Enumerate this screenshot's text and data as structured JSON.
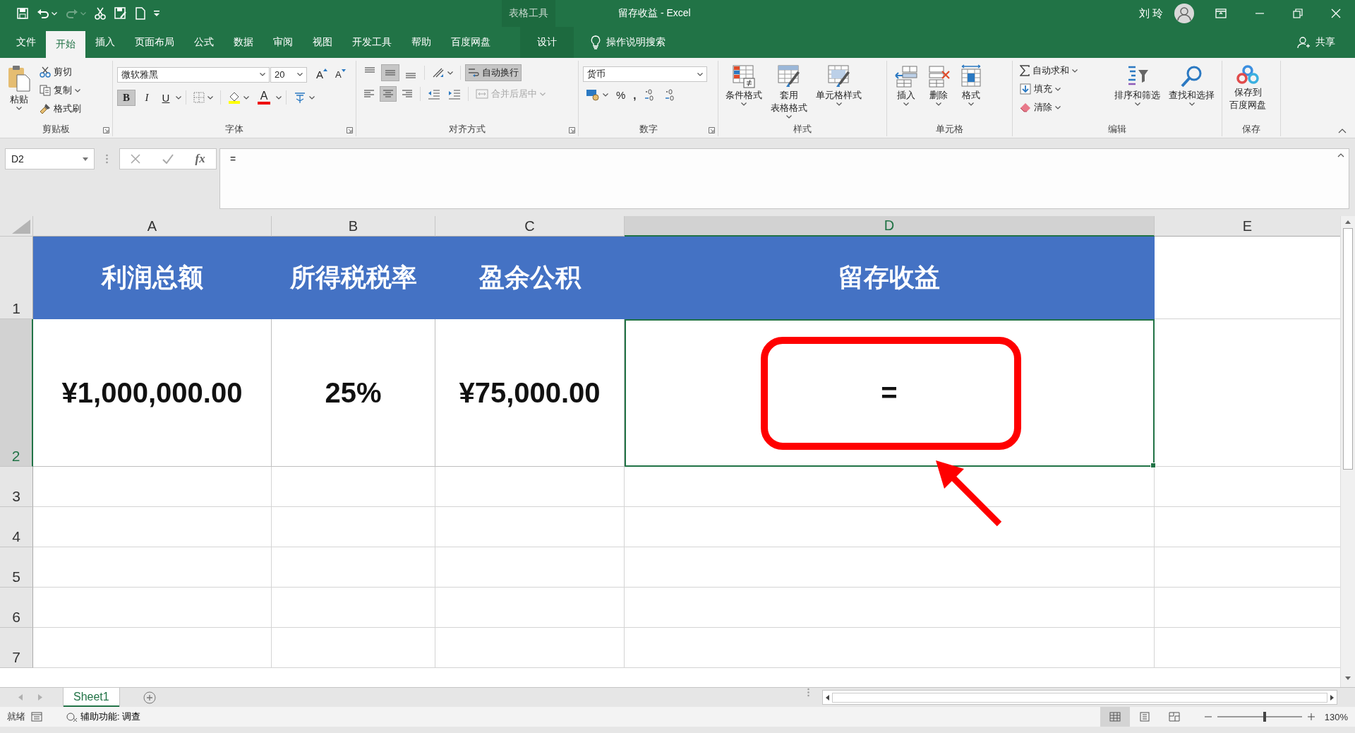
{
  "title_bar": {
    "context_group": "表格工具",
    "title": "留存收益  -  Excel",
    "user": "刘 玲"
  },
  "ribbon_tabs": [
    {
      "label": "文件",
      "selected": false,
      "kind": "normal"
    },
    {
      "label": "开始",
      "selected": true,
      "kind": "normal"
    },
    {
      "label": "插入",
      "selected": false,
      "kind": "normal"
    },
    {
      "label": "页面布局",
      "selected": false,
      "kind": "normal"
    },
    {
      "label": "公式",
      "selected": false,
      "kind": "normal"
    },
    {
      "label": "数据",
      "selected": false,
      "kind": "normal"
    },
    {
      "label": "审阅",
      "selected": false,
      "kind": "normal"
    },
    {
      "label": "视图",
      "selected": false,
      "kind": "normal"
    },
    {
      "label": "开发工具",
      "selected": false,
      "kind": "normal"
    },
    {
      "label": "帮助",
      "selected": false,
      "kind": "normal"
    },
    {
      "label": "百度网盘",
      "selected": false,
      "kind": "normal"
    },
    {
      "label": "设计",
      "selected": false,
      "kind": "context"
    }
  ],
  "tell_me": "操作说明搜索",
  "share": "共享",
  "ribbon": {
    "clipboard": {
      "label": "剪贴板",
      "paste": "粘贴",
      "cut": "剪切",
      "copy": "复制",
      "format_painter": "格式刷"
    },
    "font": {
      "label": "字体",
      "font_name": "微软雅黑",
      "font_size": "20",
      "grow": "A",
      "shrink": "A",
      "styles": [
        {
          "label": "B",
          "selected": true
        },
        {
          "label": "I",
          "selected": false
        },
        {
          "label": "U",
          "selected": false
        }
      ],
      "font_color": "A"
    },
    "alignment": {
      "label": "对齐方式",
      "vertical": [
        {
          "selected": false
        },
        {
          "selected": true
        },
        {
          "selected": false
        }
      ],
      "horizontal": [
        {
          "selected": false
        },
        {
          "selected": true
        },
        {
          "selected": false
        }
      ],
      "wrap_text": {
        "label": "自动换行",
        "selected": true
      },
      "merge": {
        "label": "合并后居中",
        "disabled": true
      }
    },
    "number": {
      "label": "数字",
      "format": "货币",
      "percent": "%",
      "comma": ","
    },
    "styles": {
      "label": "样式",
      "buttons": [
        {
          "lines": [
            "条件格式"
          ]
        },
        {
          "lines": [
            "套用",
            "表格格式"
          ]
        },
        {
          "lines": [
            "单元格样式"
          ]
        }
      ]
    },
    "cells": {
      "label": "单元格",
      "buttons": [
        "插入",
        "删除",
        "格式"
      ]
    },
    "editing": {
      "label": "编辑",
      "small": [
        "自动求和",
        "填充",
        "清除"
      ],
      "large": [
        "排序和筛选",
        "查找和选择"
      ]
    },
    "save": {
      "label": "保存",
      "lines": [
        "保存到",
        "百度网盘"
      ]
    }
  },
  "formula_bar": {
    "name_box": "D2",
    "function_button": "fx",
    "formula": "="
  },
  "sheet": {
    "columns": [
      {
        "label": "A",
        "selected": false
      },
      {
        "label": "B",
        "selected": false
      },
      {
        "label": "C",
        "selected": false
      },
      {
        "label": "D",
        "selected": true
      },
      {
        "label": "E",
        "selected": false
      }
    ],
    "rows": [
      {
        "label": "1",
        "selected": false,
        "kind": "header",
        "cells": [
          "利润总额",
          "所得税税率",
          "盈余公积",
          "留存收益"
        ]
      },
      {
        "label": "2",
        "selected": true,
        "kind": "data",
        "cells": [
          "¥1,000,000.00",
          "25%",
          "¥75,000.00",
          "="
        ]
      },
      {
        "label": "3",
        "selected": false,
        "kind": "blank"
      },
      {
        "label": "4",
        "selected": false,
        "kind": "blank"
      },
      {
        "label": "5",
        "selected": false,
        "kind": "blank"
      },
      {
        "label": "6",
        "selected": false,
        "kind": "blank"
      },
      {
        "label": "7",
        "selected": false,
        "kind": "blank"
      }
    ]
  },
  "sheet_tabs": [
    {
      "label": "Sheet1",
      "selected": true
    }
  ],
  "status_bar": {
    "mode": "就绪",
    "accessibility": "辅助功能: 调查",
    "views": [
      {
        "selected": true
      },
      {
        "selected": false
      },
      {
        "selected": false
      }
    ],
    "zoom": {
      "level": 0.56,
      "label": "130%"
    }
  }
}
